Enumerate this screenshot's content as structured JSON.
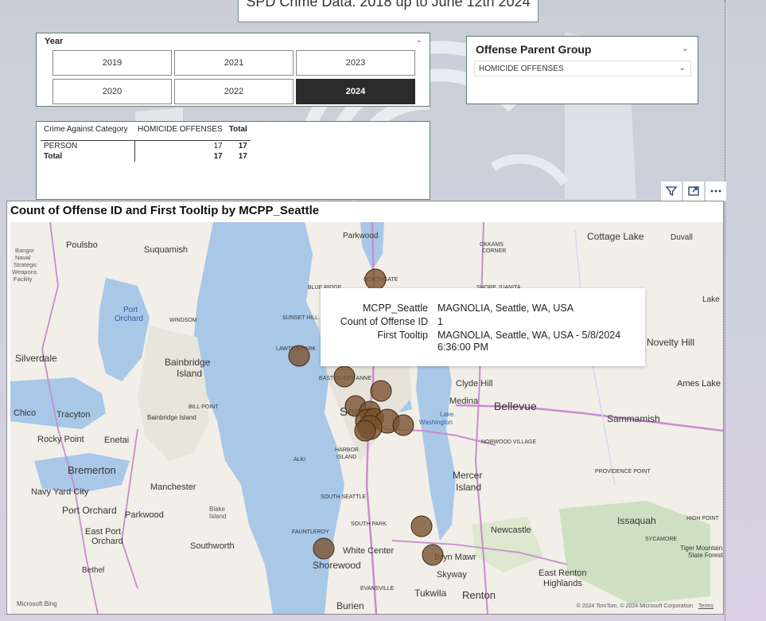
{
  "report": {
    "title_text": "SPD Crime Data: 2018 up to June 12th 2024"
  },
  "year_slicer": {
    "header": "Year",
    "options": [
      "2019",
      "2021",
      "2023",
      "2020",
      "2022",
      "2024"
    ],
    "selected": "2024"
  },
  "offense_slicer": {
    "header": "Offense Parent Group",
    "value": "HOMICIDE OFFENSES"
  },
  "matrix": {
    "headers": [
      "Crime Against Category",
      "HOMICIDE OFFENSES",
      "Total"
    ],
    "rows": [
      {
        "label": "PERSON",
        "value": "17",
        "total": "17"
      },
      {
        "label": "Total",
        "value": "17",
        "total": "17"
      }
    ]
  },
  "visual_header_icons": [
    "filter-icon",
    "focus-mode-icon",
    "more-options-icon"
  ],
  "map": {
    "title": "Count of Offense ID and First Tooltip by MCPP_Seattle",
    "place_labels": [
      "Parkwood",
      "Cottage Lake",
      "Duvall",
      "Poulsbo",
      "Suquamish",
      "Bangor",
      "Naval",
      "Strategic",
      "Weapons",
      "Facility",
      "OKKAMS",
      "CORNER",
      "NORTHGATE",
      "BLUE RIDGE",
      "SHORE JUANITA",
      "Port",
      "Orchard",
      "WINDSOM",
      "SUNSET HILL",
      "Lake",
      "LAWTON PARK",
      "Silverdale",
      "Bainbridge",
      "Island",
      "EAST QUEEN ANNE",
      "Clyde Hill",
      "Novelty Hill",
      "Ames Lake",
      "Medina",
      "Bellevue",
      "Chico",
      "Tracyton",
      "BILL POINT",
      "Bainbridge Island",
      "Seattle",
      "Lake",
      "Washington",
      "Sammamish",
      "Rocky Point",
      "Enetai",
      "NORWOOD VILLAGE",
      "ALKI",
      "HARBOR",
      "ISLAND",
      "Bremerton",
      "Manchester",
      "Mercer",
      "Island",
      "PROVIDENCE POINT",
      "Navy Yard City",
      "SOUTH SEATTLE",
      "Port Orchard",
      "Parkwood",
      "Blake",
      "Island",
      "SOUTH PARK",
      "Issaquah",
      "HIGH POINT",
      "East Port",
      "Orchard",
      "FAUNTLEROY",
      "Newcastle",
      "SYCAMORE",
      "Southworth",
      "White Center",
      "Bryn Mawr",
      "Tiger Mountain",
      "State Forest",
      "Bethel",
      "Shorewood",
      "Skyway",
      "East Renton",
      "Highlands",
      "Tukwila",
      "Renton",
      "Burien",
      "EVANSVILLE"
    ],
    "tooltip": [
      {
        "key": "MCPP_Seattle",
        "value": "MAGNOLIA, Seattle, WA, USA"
      },
      {
        "key": "Count of Offense ID",
        "value": "1"
      },
      {
        "key": "First Tooltip",
        "value": "MAGNOLIA, Seattle, WA, USA - 5/8/2024",
        "value2": "6:36:00 PM"
      }
    ],
    "attribution": "© 2024 TomTom, © 2024 Microsoft Corporation",
    "terms": "Terms",
    "bing": "Microsoft Bing",
    "bubble_color": "#7a5230"
  }
}
